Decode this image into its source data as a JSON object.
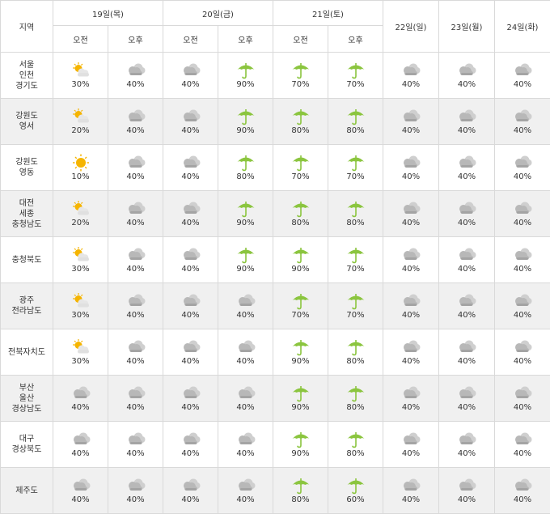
{
  "header": {
    "region_label": "지역",
    "days": [
      {
        "label": "19일(목)",
        "split": true
      },
      {
        "label": "20일(금)",
        "split": true
      },
      {
        "label": "21일(토)",
        "split": true
      },
      {
        "label": "22일(일)",
        "split": false
      },
      {
        "label": "23일(월)",
        "split": false
      },
      {
        "label": "24일(화)",
        "split": false
      }
    ],
    "am_label": "오전",
    "pm_label": "오후"
  },
  "rows": [
    {
      "region": [
        "서울",
        "인천",
        "경기도"
      ],
      "cells": [
        {
          "icon": "partly-sunny-icon",
          "pct": "30%"
        },
        {
          "icon": "cloudy-icon",
          "pct": "40%"
        },
        {
          "icon": "cloudy-icon",
          "pct": "40%"
        },
        {
          "icon": "umbrella-icon",
          "pct": "90%"
        },
        {
          "icon": "umbrella-icon",
          "pct": "70%"
        },
        {
          "icon": "umbrella-icon",
          "pct": "70%"
        },
        {
          "icon": "cloudy-icon",
          "pct": "40%"
        },
        {
          "icon": "cloudy-icon",
          "pct": "40%"
        },
        {
          "icon": "cloudy-icon",
          "pct": "40%"
        }
      ]
    },
    {
      "region": [
        "강원도",
        "영서"
      ],
      "cells": [
        {
          "icon": "partly-sunny-icon",
          "pct": "20%"
        },
        {
          "icon": "cloudy-icon",
          "pct": "40%"
        },
        {
          "icon": "cloudy-icon",
          "pct": "40%"
        },
        {
          "icon": "umbrella-icon",
          "pct": "90%"
        },
        {
          "icon": "umbrella-icon",
          "pct": "80%"
        },
        {
          "icon": "umbrella-icon",
          "pct": "80%"
        },
        {
          "icon": "cloudy-icon",
          "pct": "40%"
        },
        {
          "icon": "cloudy-icon",
          "pct": "40%"
        },
        {
          "icon": "cloudy-icon",
          "pct": "40%"
        }
      ]
    },
    {
      "region": [
        "강원도",
        "영동"
      ],
      "cells": [
        {
          "icon": "sunny-icon",
          "pct": "10%"
        },
        {
          "icon": "cloudy-icon",
          "pct": "40%"
        },
        {
          "icon": "cloudy-icon",
          "pct": "40%"
        },
        {
          "icon": "umbrella-icon",
          "pct": "80%"
        },
        {
          "icon": "umbrella-icon",
          "pct": "70%"
        },
        {
          "icon": "umbrella-icon",
          "pct": "70%"
        },
        {
          "icon": "cloudy-icon",
          "pct": "40%"
        },
        {
          "icon": "cloudy-icon",
          "pct": "40%"
        },
        {
          "icon": "cloudy-icon",
          "pct": "40%"
        }
      ]
    },
    {
      "region": [
        "대전",
        "세종",
        "충청남도"
      ],
      "cells": [
        {
          "icon": "partly-sunny-icon",
          "pct": "20%"
        },
        {
          "icon": "cloudy-icon",
          "pct": "40%"
        },
        {
          "icon": "cloudy-icon",
          "pct": "40%"
        },
        {
          "icon": "umbrella-icon",
          "pct": "90%"
        },
        {
          "icon": "umbrella-icon",
          "pct": "80%"
        },
        {
          "icon": "umbrella-icon",
          "pct": "80%"
        },
        {
          "icon": "cloudy-icon",
          "pct": "40%"
        },
        {
          "icon": "cloudy-icon",
          "pct": "40%"
        },
        {
          "icon": "cloudy-icon",
          "pct": "40%"
        }
      ]
    },
    {
      "region": [
        "충청북도"
      ],
      "cells": [
        {
          "icon": "partly-sunny-icon",
          "pct": "30%"
        },
        {
          "icon": "cloudy-icon",
          "pct": "40%"
        },
        {
          "icon": "cloudy-icon",
          "pct": "40%"
        },
        {
          "icon": "umbrella-icon",
          "pct": "90%"
        },
        {
          "icon": "umbrella-icon",
          "pct": "90%"
        },
        {
          "icon": "umbrella-icon",
          "pct": "70%"
        },
        {
          "icon": "cloudy-icon",
          "pct": "40%"
        },
        {
          "icon": "cloudy-icon",
          "pct": "40%"
        },
        {
          "icon": "cloudy-icon",
          "pct": "40%"
        }
      ]
    },
    {
      "region": [
        "광주",
        "전라남도"
      ],
      "cells": [
        {
          "icon": "partly-sunny-icon",
          "pct": "30%"
        },
        {
          "icon": "cloudy-icon",
          "pct": "40%"
        },
        {
          "icon": "cloudy-icon",
          "pct": "40%"
        },
        {
          "icon": "cloudy-icon",
          "pct": "40%"
        },
        {
          "icon": "umbrella-icon",
          "pct": "70%"
        },
        {
          "icon": "umbrella-icon",
          "pct": "70%"
        },
        {
          "icon": "cloudy-icon",
          "pct": "40%"
        },
        {
          "icon": "cloudy-icon",
          "pct": "40%"
        },
        {
          "icon": "cloudy-icon",
          "pct": "40%"
        }
      ]
    },
    {
      "region": [
        "전북자치도"
      ],
      "cells": [
        {
          "icon": "partly-sunny-icon",
          "pct": "30%"
        },
        {
          "icon": "cloudy-icon",
          "pct": "40%"
        },
        {
          "icon": "cloudy-icon",
          "pct": "40%"
        },
        {
          "icon": "cloudy-icon",
          "pct": "40%"
        },
        {
          "icon": "umbrella-icon",
          "pct": "90%"
        },
        {
          "icon": "umbrella-icon",
          "pct": "80%"
        },
        {
          "icon": "cloudy-icon",
          "pct": "40%"
        },
        {
          "icon": "cloudy-icon",
          "pct": "40%"
        },
        {
          "icon": "cloudy-icon",
          "pct": "40%"
        }
      ]
    },
    {
      "region": [
        "부산",
        "울산",
        "경상남도"
      ],
      "cells": [
        {
          "icon": "cloudy-icon",
          "pct": "40%"
        },
        {
          "icon": "cloudy-icon",
          "pct": "40%"
        },
        {
          "icon": "cloudy-icon",
          "pct": "40%"
        },
        {
          "icon": "cloudy-icon",
          "pct": "40%"
        },
        {
          "icon": "umbrella-icon",
          "pct": "90%"
        },
        {
          "icon": "umbrella-icon",
          "pct": "80%"
        },
        {
          "icon": "cloudy-icon",
          "pct": "40%"
        },
        {
          "icon": "cloudy-icon",
          "pct": "40%"
        },
        {
          "icon": "cloudy-icon",
          "pct": "40%"
        }
      ]
    },
    {
      "region": [
        "대구",
        "경상북도"
      ],
      "cells": [
        {
          "icon": "cloudy-icon",
          "pct": "40%"
        },
        {
          "icon": "cloudy-icon",
          "pct": "40%"
        },
        {
          "icon": "cloudy-icon",
          "pct": "40%"
        },
        {
          "icon": "cloudy-icon",
          "pct": "40%"
        },
        {
          "icon": "umbrella-icon",
          "pct": "90%"
        },
        {
          "icon": "umbrella-icon",
          "pct": "80%"
        },
        {
          "icon": "cloudy-icon",
          "pct": "40%"
        },
        {
          "icon": "cloudy-icon",
          "pct": "40%"
        },
        {
          "icon": "cloudy-icon",
          "pct": "40%"
        }
      ]
    },
    {
      "region": [
        "제주도"
      ],
      "cells": [
        {
          "icon": "cloudy-icon",
          "pct": "40%"
        },
        {
          "icon": "cloudy-icon",
          "pct": "40%"
        },
        {
          "icon": "cloudy-icon",
          "pct": "40%"
        },
        {
          "icon": "cloudy-icon",
          "pct": "40%"
        },
        {
          "icon": "umbrella-icon",
          "pct": "80%"
        },
        {
          "icon": "umbrella-icon",
          "pct": "60%"
        },
        {
          "icon": "cloudy-icon",
          "pct": "40%"
        },
        {
          "icon": "cloudy-icon",
          "pct": "40%"
        },
        {
          "icon": "cloudy-icon",
          "pct": "40%"
        }
      ]
    }
  ],
  "colors": {
    "border": "#d9d9d9",
    "row_alt": "#f0f0f0",
    "umbrella": "#8bc53f",
    "sun": "#f5b400",
    "cloud": "#b8b8b8"
  }
}
